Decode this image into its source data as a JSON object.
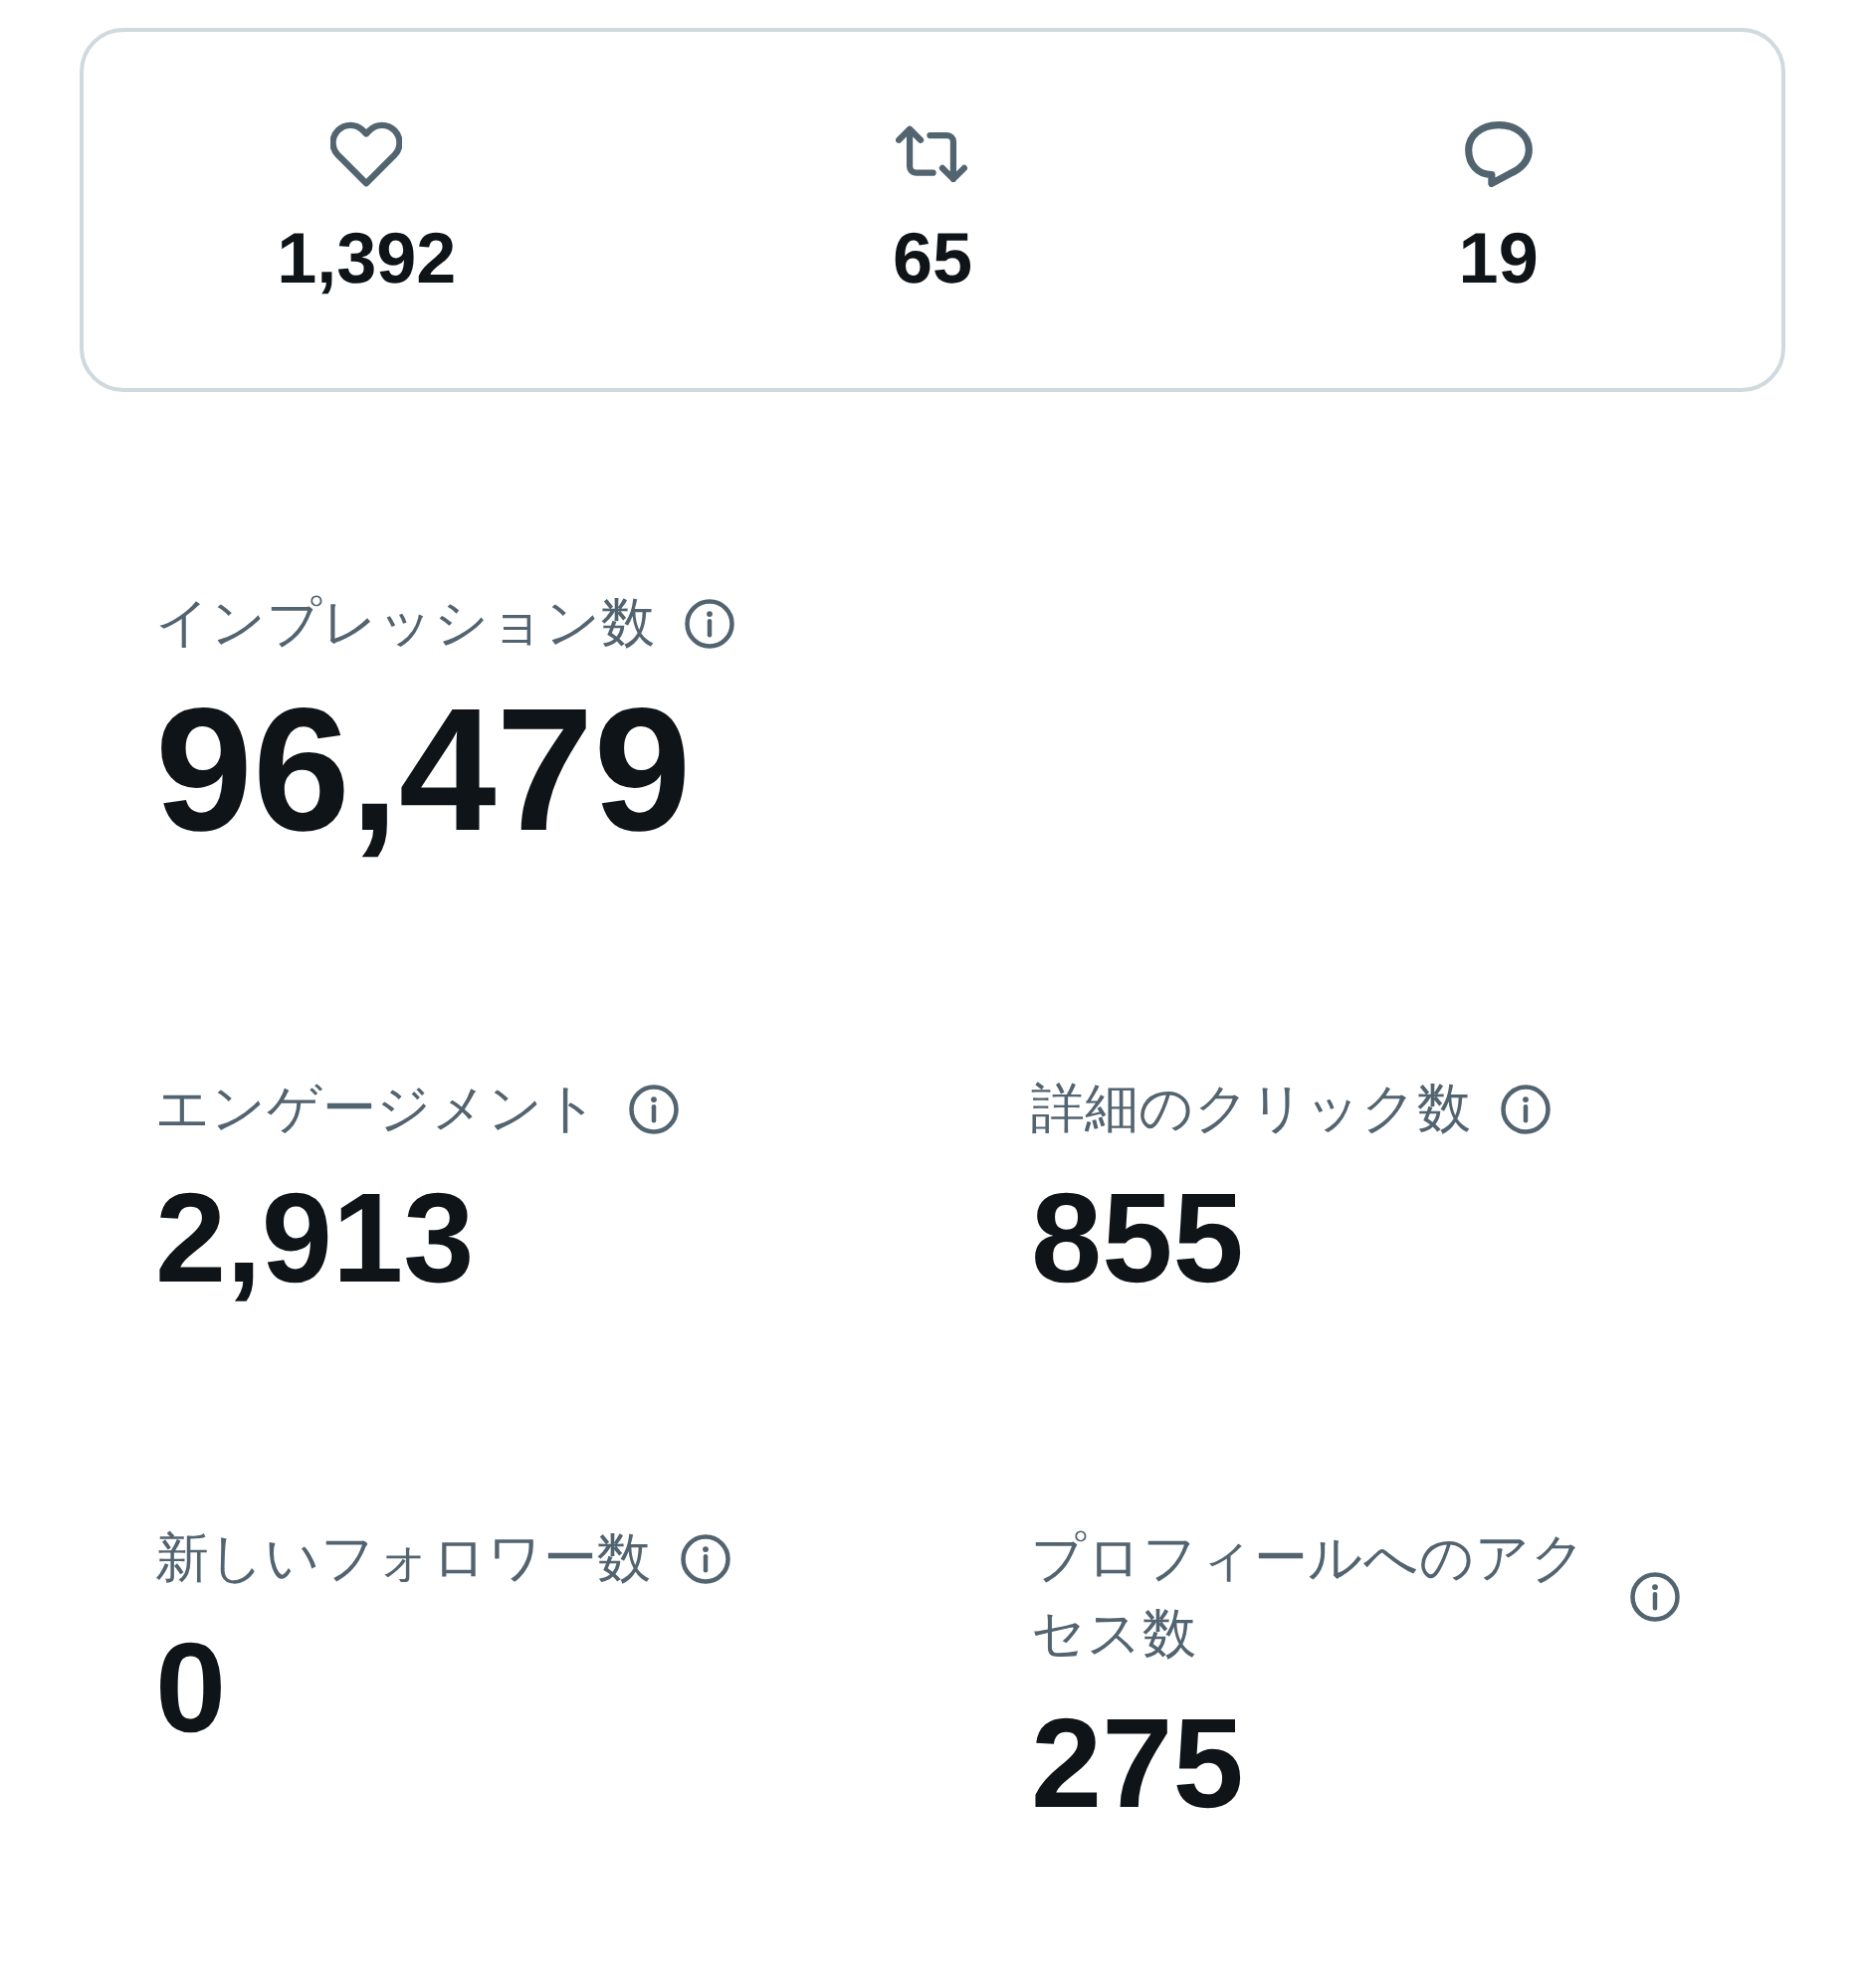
{
  "engagement_summary": [
    {
      "kind": "like",
      "count": "1,392"
    },
    {
      "kind": "repost",
      "count": "65"
    },
    {
      "kind": "reply",
      "count": "19"
    }
  ],
  "impressions": {
    "label": "インプレッション数",
    "value": "96,479"
  },
  "metrics": [
    {
      "label": "エンゲージメント",
      "value": "2,913"
    },
    {
      "label": "詳細のクリック数",
      "value": "855"
    },
    {
      "label": "新しいフォロワー数",
      "value": "0"
    },
    {
      "label": "プロフィールへのアクセス数",
      "value": "275"
    }
  ]
}
